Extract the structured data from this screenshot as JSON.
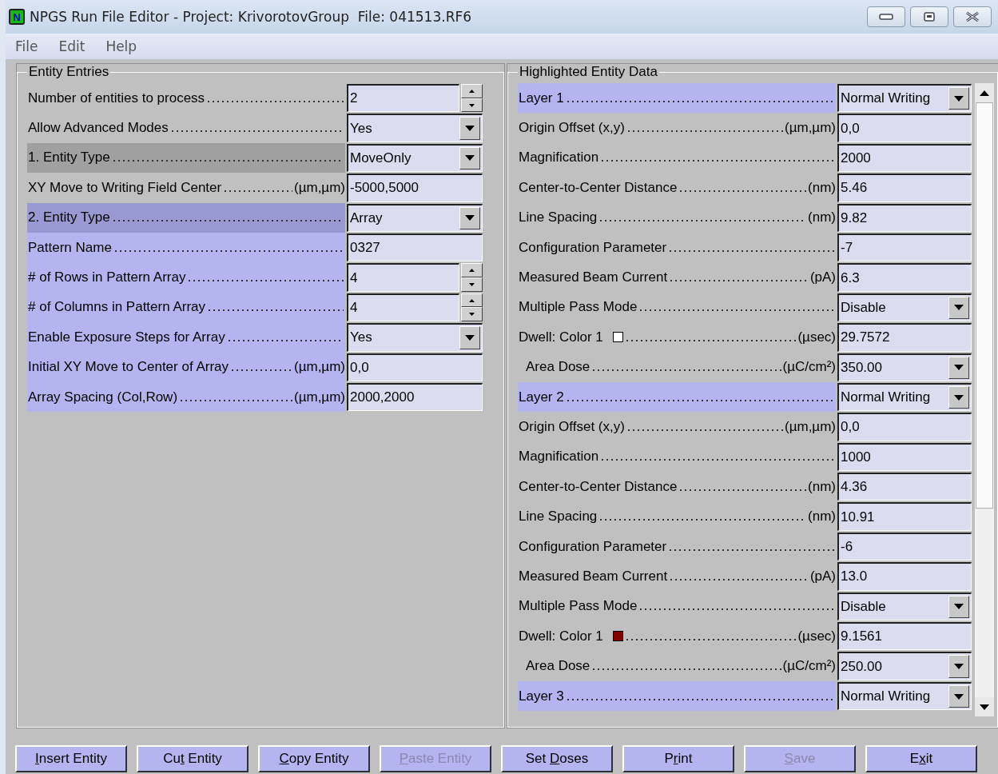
{
  "window": {
    "icon_letter": "N",
    "title": "NPGS Run File Editor - Project: KrivorotovGroup  File: 041513.RF6"
  },
  "menu": [
    "File",
    "Edit",
    "Help"
  ],
  "entity_entries": {
    "title": "Entity Entries",
    "rows": [
      {
        "label": "Number of entities to process",
        "value": "2",
        "kind": "spinner",
        "color": "#c0c0c0"
      },
      {
        "label": "Allow Advanced Modes",
        "value": "Yes",
        "kind": "dropdown",
        "color": "#c0c0c0"
      },
      {
        "label": "1. Entity Type",
        "value": "MoveOnly",
        "kind": "dropdown",
        "color": "#a0a0a0"
      },
      {
        "label": "XY Move to Writing Field Center",
        "unit": "(µm,µm)",
        "value": "-5000,5000",
        "kind": "text",
        "color": "#c0c0c0"
      },
      {
        "label": "2. Entity Type",
        "value": "Array",
        "kind": "dropdown",
        "color": "#9898d2"
      },
      {
        "label": "Pattern Name",
        "value": "0327",
        "kind": "text",
        "color": "#b4b4f0"
      },
      {
        "label": "# of Rows in Pattern Array",
        "value": "4",
        "kind": "spinner",
        "color": "#b4b4f0"
      },
      {
        "label": "# of Columns in Pattern Array",
        "value": "4",
        "kind": "spinner",
        "color": "#b4b4f0"
      },
      {
        "label": "Enable Exposure Steps for Array",
        "value": "Yes",
        "kind": "dropdown",
        "color": "#b4b4f0"
      },
      {
        "label": "Initial XY Move to Center of Array",
        "unit": "(µm,µm)",
        "value": "0,0",
        "kind": "text",
        "color": "#b4b4f0"
      },
      {
        "label": "Array Spacing (Col,Row)",
        "unit": "(µm,µm)",
        "value": "2000,2000",
        "kind": "text",
        "color": "#b4b4f0"
      }
    ]
  },
  "highlighted_entity_data": {
    "title": "Highlighted Entity Data",
    "layers": [
      {
        "label": "Layer 1",
        "mode": "Normal Writing",
        "fields": [
          {
            "label": "Origin Offset (x,y)",
            "unit": "(µm,µm)",
            "value": "0,0",
            "kind": "text"
          },
          {
            "label": "Magnification",
            "value": "2000",
            "kind": "text"
          },
          {
            "label": "Center-to-Center Distance",
            "unit": "(nm)",
            "value": "5.46",
            "kind": "text"
          },
          {
            "label": "Line Spacing",
            "unit": "(nm)",
            "value": "9.82",
            "kind": "text"
          },
          {
            "label": "Configuration Parameter",
            "value": "-7",
            "kind": "text"
          },
          {
            "label": "Measured Beam Current",
            "unit": "(pA)",
            "value": "6.3",
            "kind": "text"
          },
          {
            "label": "Multiple Pass Mode",
            "value": "Disable",
            "kind": "dropdown"
          },
          {
            "label": "Dwell: Color 1",
            "color": "#ffffff",
            "unit": "(µsec)",
            "value": "29.7572",
            "kind": "text",
            "children": [
              {
                "label": "Area Dose",
                "unit": "(µC/cm²)",
                "value": "350.00",
                "kind": "dropdown"
              }
            ]
          }
        ]
      },
      {
        "label": "Layer 2",
        "mode": "Normal Writing",
        "fields": [
          {
            "label": "Origin Offset (x,y)",
            "unit": "(µm,µm)",
            "value": "0,0",
            "kind": "text"
          },
          {
            "label": "Magnification",
            "value": "1000",
            "kind": "text"
          },
          {
            "label": "Center-to-Center Distance",
            "unit": "(nm)",
            "value": "4.36",
            "kind": "text"
          },
          {
            "label": "Line Spacing",
            "unit": "(nm)",
            "value": "10.91",
            "kind": "text"
          },
          {
            "label": "Configuration Parameter",
            "value": "-6",
            "kind": "text"
          },
          {
            "label": "Measured Beam Current",
            "unit": "(pA)",
            "value": "13.0",
            "kind": "text"
          },
          {
            "label": "Multiple Pass Mode",
            "value": "Disable",
            "kind": "dropdown"
          },
          {
            "label": "Dwell: Color 1",
            "color": "#800000",
            "unit": "(µsec)",
            "value": "9.1561",
            "kind": "text",
            "children": [
              {
                "label": "Area Dose",
                "unit": "(µC/cm²)",
                "value": "250.00",
                "kind": "dropdown"
              }
            ]
          }
        ]
      },
      {
        "label": "Layer 3",
        "mode": "Normal Writing"
      }
    ]
  },
  "buttons": [
    {
      "access_key": "I",
      "after": "nsert Entity",
      "disabled": false
    },
    {
      "before": "Cu",
      "access_key": "t",
      "after": " Entity",
      "disabled": false
    },
    {
      "access_key": "C",
      "after": "opy Entity",
      "disabled": false
    },
    {
      "access_key": "P",
      "after": "aste Entity",
      "disabled": true
    },
    {
      "before": "Set ",
      "access_key": "D",
      "after": "oses",
      "disabled": false
    },
    {
      "before": "P",
      "access_key": "r",
      "after": "int",
      "disabled": false
    },
    {
      "access_key": "S",
      "after": "ave",
      "disabled": true
    },
    {
      "before": "E",
      "access_key": "x",
      "after": "it",
      "disabled": false
    }
  ]
}
